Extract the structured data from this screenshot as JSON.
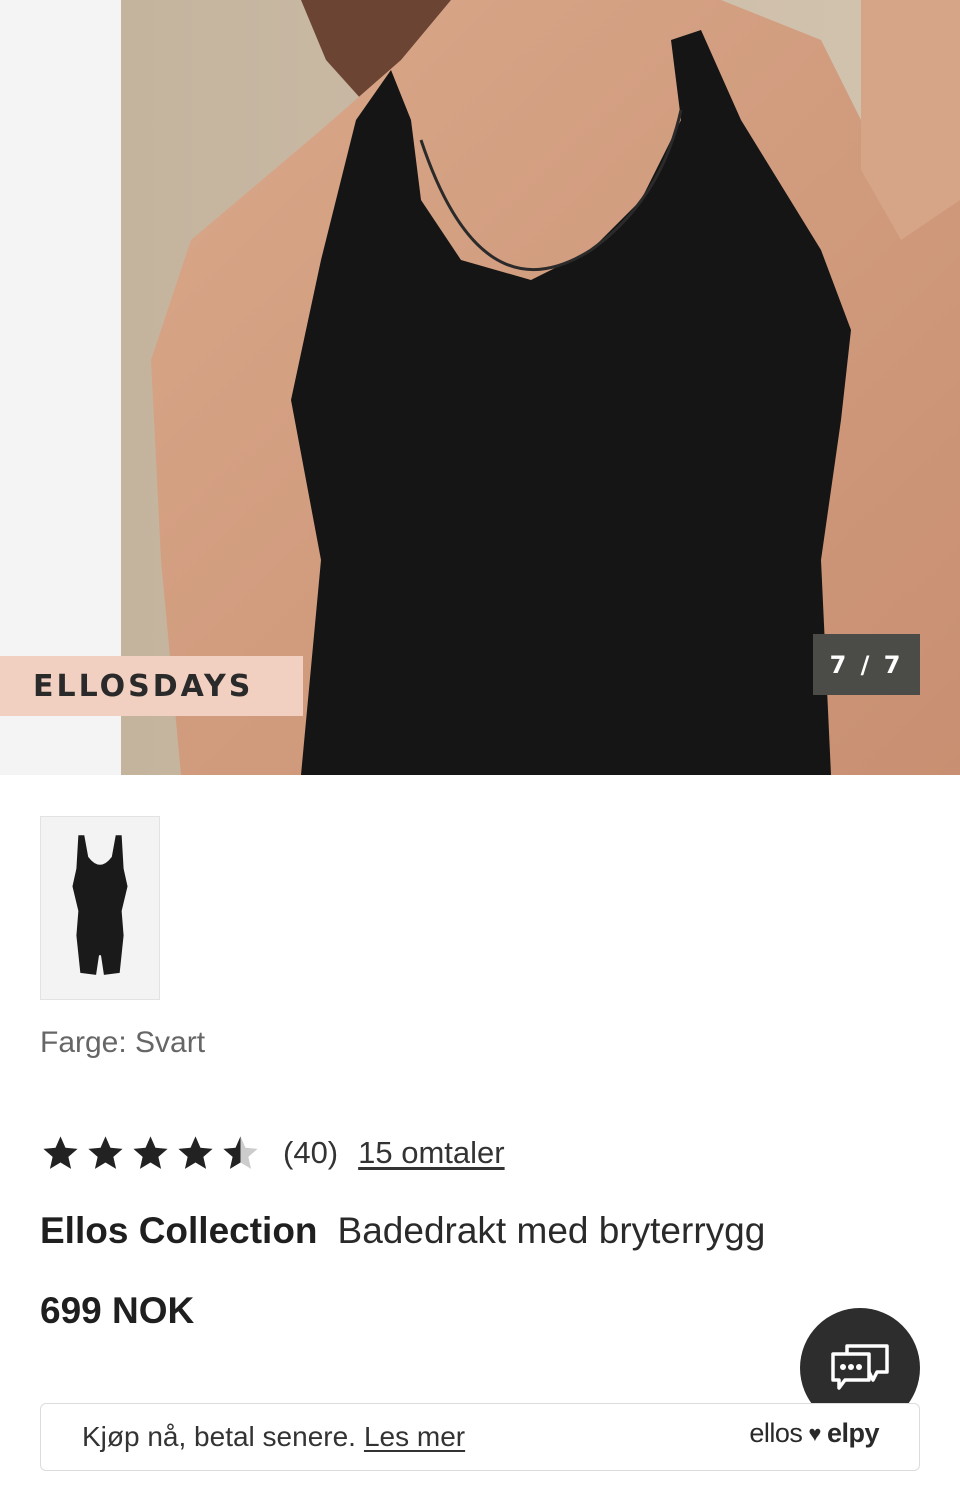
{
  "gallery": {
    "promo_label": "ELLOSDAYS",
    "image_counter": "7 / 7"
  },
  "product": {
    "color_label": "Farge: Svart",
    "rating": 4.5,
    "rating_max": 5,
    "rating_count": "(40)",
    "reviews_link": "15 omtaler",
    "brand": "Ellos Collection",
    "name": "Badedrakt med bryterrygg",
    "price": "699 NOK"
  },
  "finance": {
    "text": "Kjøp nå, betal senere.",
    "link": "Les mer",
    "logo_left": "ellos",
    "logo_right": "elpy"
  },
  "icons": {
    "chat": "chat-bubbles-icon",
    "star": "star-icon",
    "heart": "heart-icon"
  },
  "colors": {
    "promo_bg": "#f1d0c1",
    "counter_bg": "#4b4b47",
    "chat_bg": "#2d2d2d",
    "star": "#222222",
    "star_empty": "#cccccc"
  }
}
